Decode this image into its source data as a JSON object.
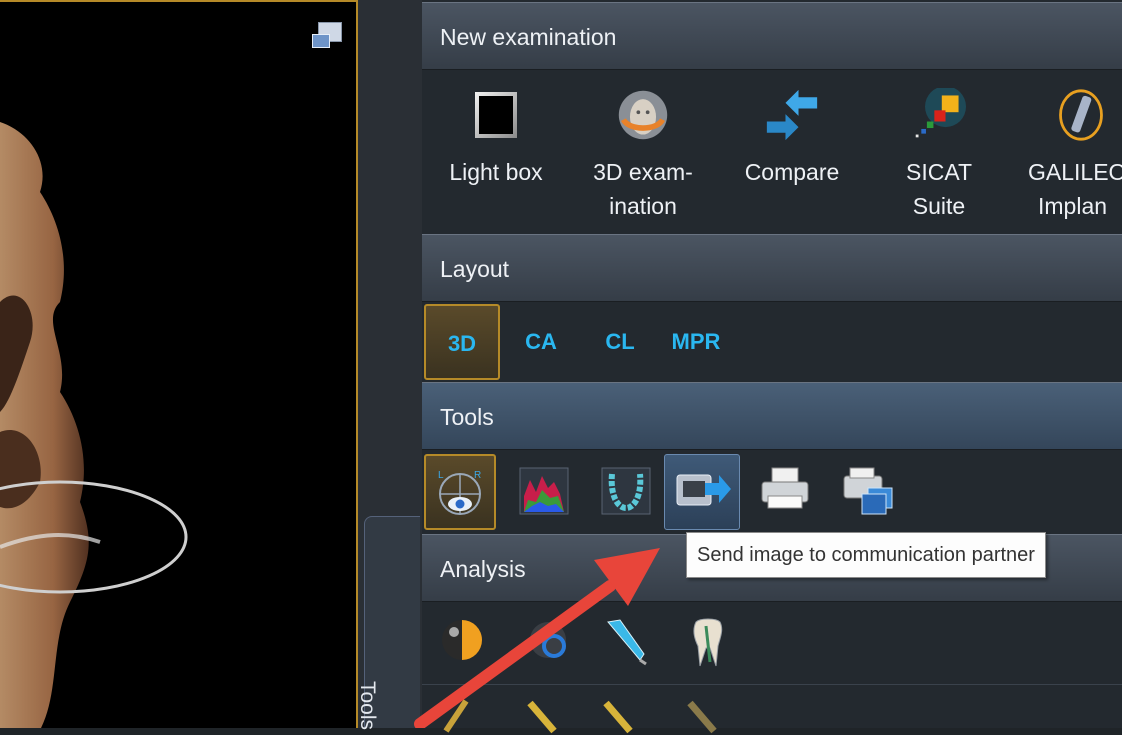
{
  "viewport": {
    "window_icon": "window-restore-icon"
  },
  "side_tab": {
    "label": "Tools"
  },
  "sections": {
    "new_examination": {
      "title": "New examination",
      "buttons": [
        {
          "label_line1": "Light box",
          "label_line2": "",
          "icon": "light-box-icon"
        },
        {
          "label_line1": "3D exam-",
          "label_line2": "ination",
          "icon": "head-3d-icon"
        },
        {
          "label_line1": "Compare",
          "label_line2": "",
          "icon": "compare-arrows-icon"
        },
        {
          "label_line1": "SICAT",
          "label_line2": "Suite",
          "icon": "sicat-icon"
        },
        {
          "label_line1": "GALILEO",
          "label_line2": "Implan",
          "icon": "galileos-implant-icon"
        }
      ]
    },
    "layout": {
      "title": "Layout",
      "tabs": [
        "3D",
        "CA",
        "CL",
        "MPR"
      ],
      "active": "3D"
    },
    "tools": {
      "title": "Tools",
      "buttons": [
        {
          "icon": "orientation-eye-icon",
          "state": "active"
        },
        {
          "icon": "histogram-icon",
          "state": "normal"
        },
        {
          "icon": "dental-arch-icon",
          "state": "normal"
        },
        {
          "icon": "send-image-icon",
          "state": "hover"
        },
        {
          "icon": "printer-icon",
          "state": "normal"
        },
        {
          "icon": "multi-printer-icon",
          "state": "normal"
        }
      ],
      "tooltip": "Send image to communication partner"
    },
    "analysis": {
      "title": "Analysis",
      "buttons": [
        {
          "icon": "sphere-icon"
        },
        {
          "icon": "ring-icon"
        },
        {
          "icon": "measure-pen-icon"
        },
        {
          "icon": "tooth-icon"
        }
      ]
    }
  },
  "colors": {
    "accent_gold": "#b58a28",
    "layout_text": "#2ab7f0",
    "annotation_arrow": "#e8453a"
  }
}
